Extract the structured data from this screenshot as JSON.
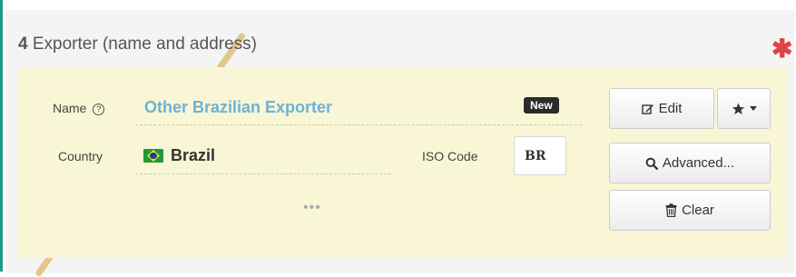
{
  "section": {
    "number": "4",
    "title": "Exporter (name and address)",
    "required_mark": "✱"
  },
  "fields": {
    "name_label": "Name",
    "help_glyph": "?",
    "name_value": "Other Brazilian Exporter",
    "new_badge": "New",
    "country_label": "Country",
    "country_flag": "brazil-flag-icon",
    "country_value": "Brazil",
    "iso_label": "ISO Code",
    "iso_value": "BR",
    "more_glyph": "•••"
  },
  "buttons": {
    "edit_label": "Edit",
    "advanced_label": "Advanced...",
    "clear_label": "Clear"
  },
  "colors": {
    "accent": "#1a9c87",
    "required": "#e04343",
    "link": "#6cb2d8",
    "box_background": "#f8f6d4"
  }
}
